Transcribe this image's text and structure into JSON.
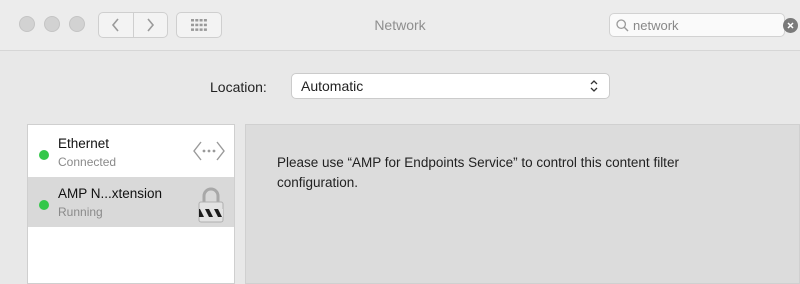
{
  "window": {
    "title": "Network"
  },
  "toolbar": {
    "back_icon": "chevron-left-icon",
    "forward_icon": "chevron-right-icon",
    "show_all_icon": "grid-icon"
  },
  "search": {
    "value": "network",
    "icon": "search-icon",
    "clear_icon": "clear-circle-icon"
  },
  "location": {
    "label": "Location:",
    "value": "Automatic"
  },
  "services": [
    {
      "name": "Ethernet",
      "status": "Connected",
      "status_color": "#34c74a",
      "icon": "ethernet-arrows-icon",
      "selected": false
    },
    {
      "name": "AMP N...xtension",
      "status": "Running",
      "status_color": "#34c74a",
      "icon": "lock-icon",
      "selected": true
    }
  ],
  "detail": {
    "message": "Please use “AMP for Endpoints Service” to control this content filter configuration."
  }
}
